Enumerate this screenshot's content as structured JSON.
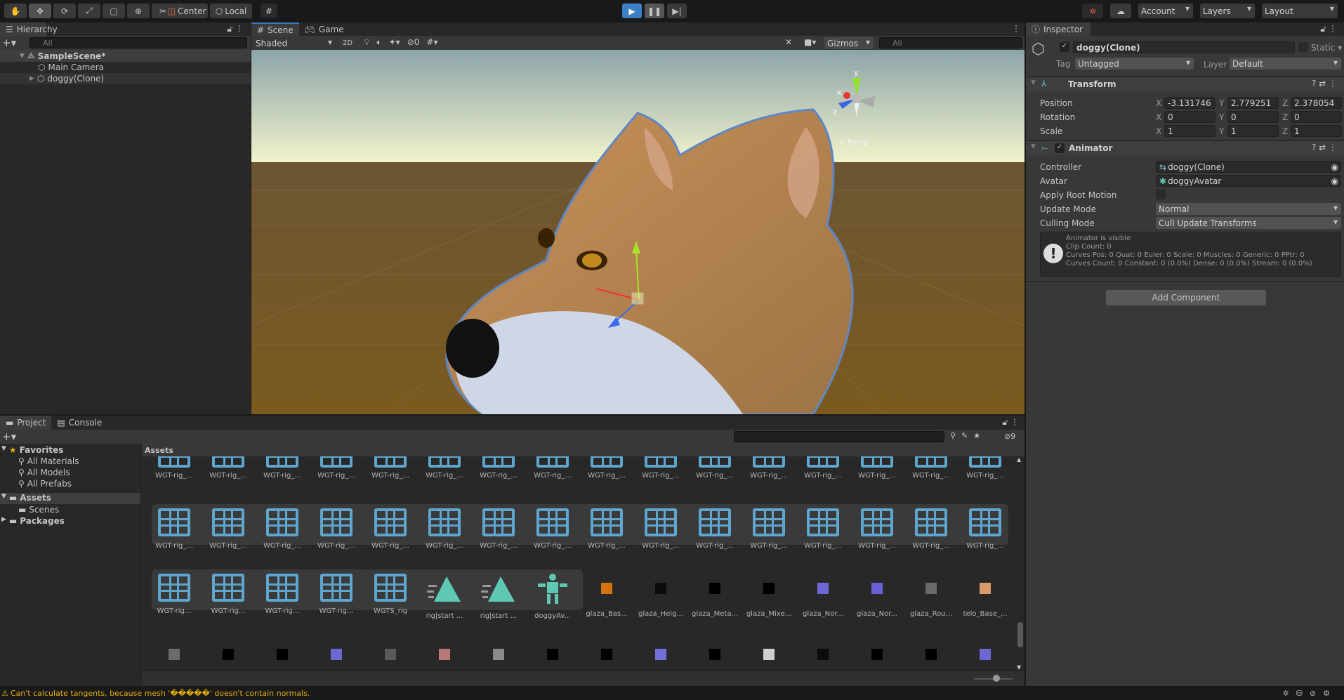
{
  "toolbar": {
    "tools": [
      "hand-tool",
      "move-tool",
      "rotate-tool",
      "scale-tool",
      "rect-tool",
      "transform-tool",
      "custom-tool"
    ],
    "pivot": "Center",
    "space": "Local",
    "account": "Account",
    "layers": "Layers",
    "layout": "Layout"
  },
  "hierarchy": {
    "title": "Hierarchy",
    "search_placeholder": "All",
    "scene": "SampleScene*",
    "items": [
      "Main Camera",
      "doggy(Clone)"
    ]
  },
  "scene": {
    "tabs": [
      "Scene",
      "Game"
    ],
    "shading": "Shaded",
    "mode2d": "2D",
    "hidden_count": "0",
    "gizmos": "Gizmos",
    "search_placeholder": "All",
    "persp": "< Persp",
    "axes": {
      "x": "x",
      "y": "y",
      "z": "z"
    }
  },
  "inspector": {
    "title": "Inspector",
    "name": "doggy(Clone)",
    "static": "Static",
    "tag_label": "Tag",
    "tag": "Untagged",
    "layer_label": "Layer",
    "layer": "Default",
    "transform": {
      "title": "Transform",
      "rows": [
        {
          "label": "Position",
          "x": "-3.131746",
          "y": "2.779251",
          "z": "2.378054"
        },
        {
          "label": "Rotation",
          "x": "0",
          "y": "0",
          "z": "0"
        },
        {
          "label": "Scale",
          "x": "1",
          "y": "1",
          "z": "1"
        }
      ]
    },
    "animator": {
      "title": "Animator",
      "controller_label": "Controller",
      "controller": "doggy(Clone)",
      "avatar_label": "Avatar",
      "avatar": "doggyAvatar",
      "root_motion_label": "Apply Root Motion",
      "update_label": "Update Mode",
      "update": "Normal",
      "culling_label": "Culling Mode",
      "culling": "Cull Update Transforms",
      "info": [
        "Animator is visible",
        "Clip Count: 0",
        "Curves Pos: 0 Quat: 0 Euler: 0 Scale: 0 Muscles: 0 Generic: 0 PPtr: 0",
        "Curves Count: 0 Constant: 0 (0.0%) Dense: 0 (0.0%) Stream: 0 (0.0%)"
      ]
    },
    "add_component": "Add Component"
  },
  "project": {
    "tabs": [
      "Project",
      "Console"
    ],
    "hidden_count": "9",
    "breadcrumb": "Assets",
    "favorites": {
      "label": "Favorites",
      "items": [
        "All Materials",
        "All Models",
        "All Prefabs"
      ]
    },
    "tree": [
      {
        "label": "Assets",
        "children": [
          "Scenes"
        ]
      },
      {
        "label": "Packages",
        "children": []
      }
    ],
    "row1": [
      "WGT-rig_...",
      "WGT-rig_...",
      "WGT-rig_...",
      "WGT-rig_...",
      "WGT-rig_...",
      "WGT-rig_...",
      "WGT-rig_...",
      "WGT-rig_...",
      "WGT-rig_...",
      "WGT-rig_...",
      "WGT-rig_...",
      "WGT-rig_...",
      "WGT-rig_...",
      "WGT-rig_...",
      "WGT-rig_...",
      "WGT-rig_..."
    ],
    "row2": [
      "WGT-rig_...",
      "WGT-rig_...",
      "WGT-rig_...",
      "WGT-rig_...",
      "WGT-rig_...",
      "WGT-rig_...",
      "WGT-rig_...",
      "WGT-rig_...",
      "WGT-rig_...",
      "WGT-rig_...",
      "WGT-rig_...",
      "WGT-rig_...",
      "WGT-rig_...",
      "WGT-rig_...",
      "WGT-rig_...",
      "WGT-rig_..."
    ],
    "row3": [
      {
        "name": "WGT-rig...",
        "icon": "grid"
      },
      {
        "name": "WGT-rig...",
        "icon": "grid"
      },
      {
        "name": "WGT-rig...",
        "icon": "grid"
      },
      {
        "name": "WGT-rig...",
        "icon": "grid"
      },
      {
        "name": "WGTS_rig",
        "icon": "grid"
      },
      {
        "name": "rig|start ...",
        "icon": "anim"
      },
      {
        "name": "rig|start ...",
        "icon": "anim"
      },
      {
        "name": "doggyAv...",
        "icon": "avatar"
      },
      {
        "name": "glaza_Bas...",
        "color": "#d6720a"
      },
      {
        "name": "glaza_Heig...",
        "color": "#0c0c0c"
      },
      {
        "name": "glaza_Meta...",
        "color": "#000000"
      },
      {
        "name": "glaza_Mixe...",
        "color": "#000000"
      },
      {
        "name": "glaza_Nor...",
        "color": "#6b67d3"
      },
      {
        "name": "glaza_Nor...",
        "color": "#6b5fd8"
      },
      {
        "name": "glaza_Rou...",
        "color": "#6a6a6a"
      },
      {
        "name": "telo_Base_...",
        "color": "#d99a6a"
      }
    ],
    "row4_colors": [
      "#6b6b6b",
      "#000000",
      "#000000",
      "#6b67d3",
      "#5a5a5a",
      "#b87878",
      "#8a8a8a",
      "#000000",
      "#000000",
      "#7070d8",
      "#000000",
      "#d0d0d0",
      "#0c0c0c",
      "#000000",
      "#000000",
      "#6b67d3"
    ]
  },
  "status": {
    "message": "Can't calculate tangents, because mesh '�����' doesn't contain normals."
  },
  "colors": {
    "accent": "#3a79bb",
    "warning": "#e6b000",
    "icon_blue": "#5fa6cf",
    "icon_teal": "#5ec8b4"
  }
}
